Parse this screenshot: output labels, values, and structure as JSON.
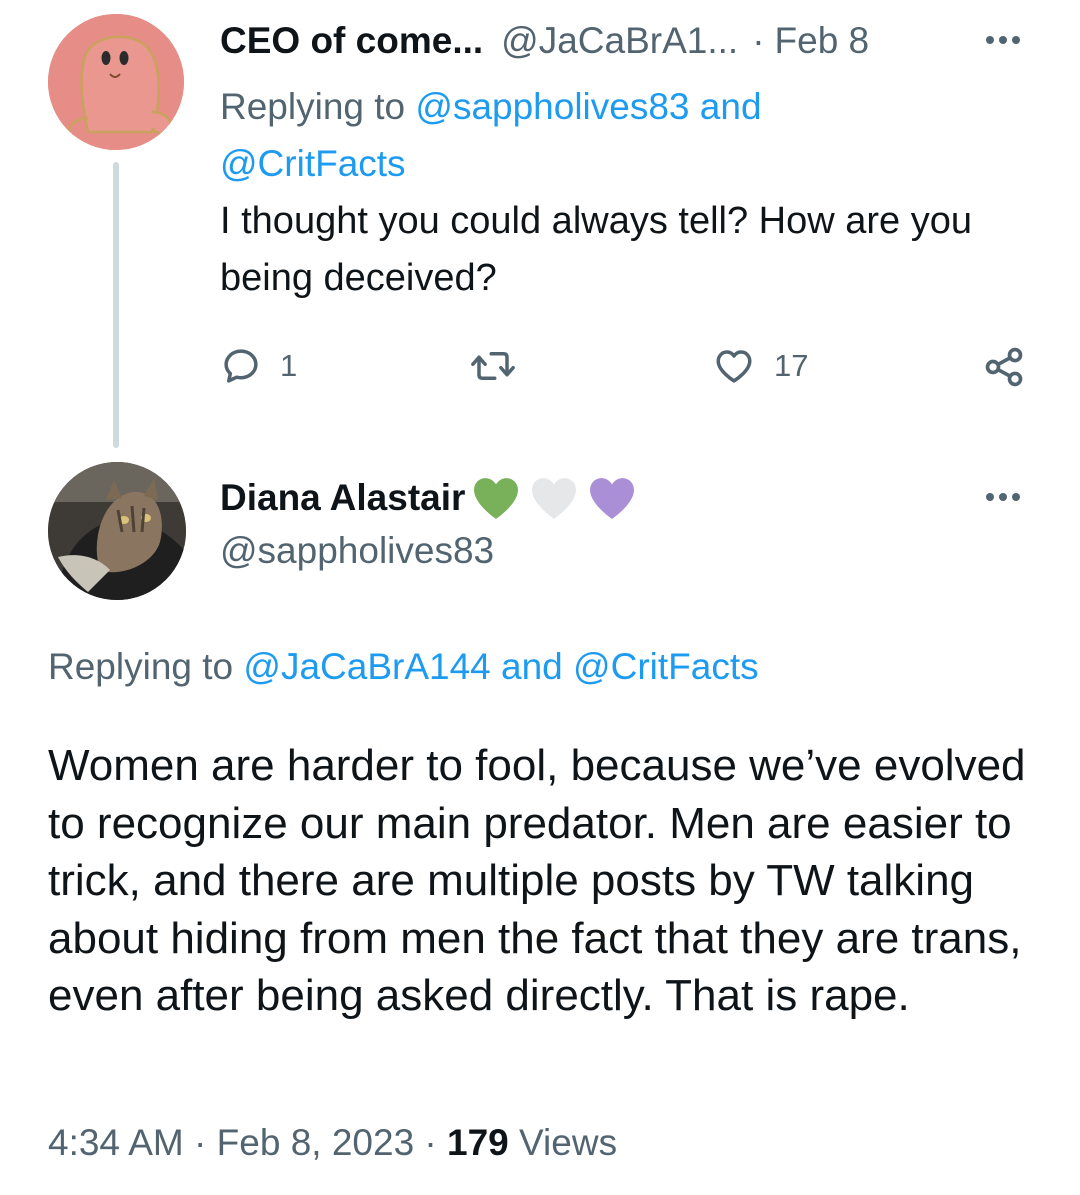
{
  "reply_tweet": {
    "author_name": "CEO of come...",
    "author_handle": "@JaCaBrA1...",
    "separator": "·",
    "date": "Feb 8",
    "replying_prefix": "Replying to",
    "replying_mention1": "@sappholives83",
    "replying_and": "and",
    "replying_mention2": "@CritFacts",
    "text": "I thought you could always tell? How are you being deceived?",
    "reply_count": "1",
    "retweet_count": "",
    "like_count": "17"
  },
  "main_tweet": {
    "author_name": "Diana Alastair",
    "author_handle": "@sappholives83",
    "name_emojis": [
      "green-heart",
      "white-heart",
      "purple-heart"
    ],
    "replying_prefix": "Replying to",
    "replying_mention1": "@JaCaBrA144",
    "replying_and": "and",
    "replying_mention2": "@CritFacts",
    "text": "Women are harder to fool, because we’ve evolved to recognize our main predator. Men are easier to trick, and there are multiple posts by TW talking about hiding from men the fact that they are trans, even after being asked directly. That is rape.",
    "time": "4:34 AM",
    "separator": "·",
    "date": "Feb 8, 2023",
    "views_count": "179",
    "views_label": "Views"
  },
  "colors": {
    "link": "#1d9bf0",
    "secondary_text": "#536471",
    "primary_text": "#0f1419",
    "thread_line": "#cfd9de",
    "green_heart": "#78b159",
    "white_heart": "#e6e7e8",
    "purple_heart": "#aa8ed6"
  }
}
